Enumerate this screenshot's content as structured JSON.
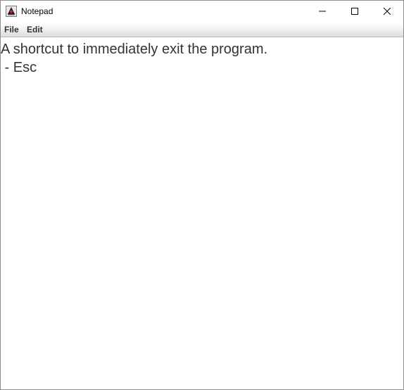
{
  "window": {
    "title": "Notepad",
    "app_icon": "java-duke-icon",
    "controls": {
      "minimize_icon": "minimize-icon",
      "maximize_icon": "maximize-icon",
      "close_icon": "close-icon"
    }
  },
  "menubar": {
    "items": [
      {
        "label": "File"
      },
      {
        "label": "Edit"
      }
    ]
  },
  "editor": {
    "lines": [
      "A shortcut to immediately exit the program.",
      " - Esc"
    ]
  },
  "colors": {
    "text": "#333333",
    "background": "#ffffff",
    "menubar_gradient_end": "#dcdcdc"
  }
}
